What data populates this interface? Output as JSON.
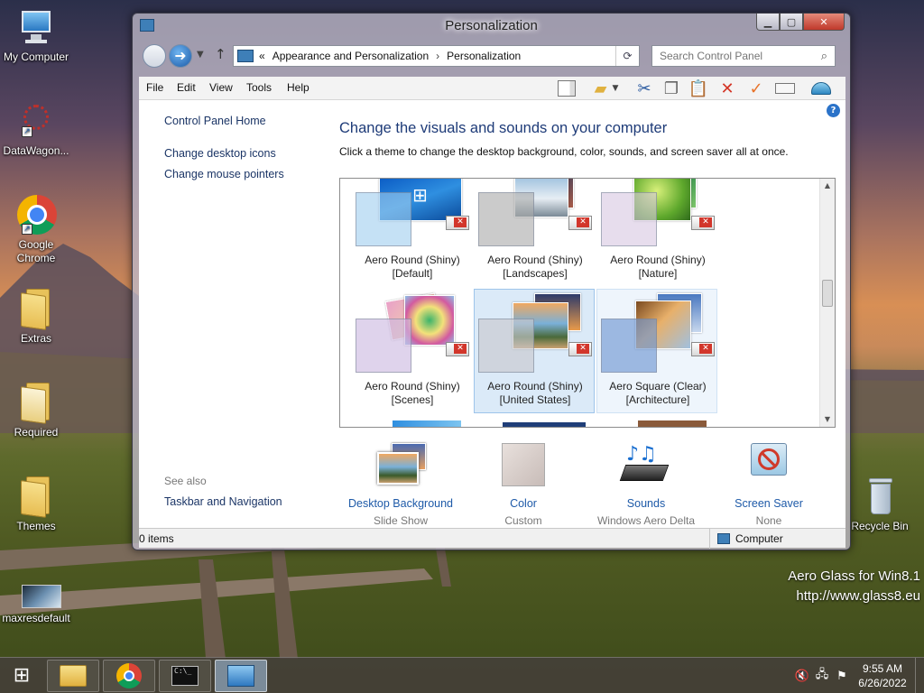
{
  "desktop": {
    "icons": [
      {
        "label": "My Computer"
      },
      {
        "label": "DataWagon..."
      },
      {
        "label": "Google Chrome"
      },
      {
        "label": "Extras"
      },
      {
        "label": "Required"
      },
      {
        "label": "Themes"
      },
      {
        "label": "maxresdefault"
      },
      {
        "label": "Recycle Bin"
      }
    ],
    "watermark": {
      "line1": "Aero Glass for Win8.1",
      "line2": "http://www.glass8.eu"
    }
  },
  "window": {
    "title": "Personalization",
    "controls": {
      "minimize": "▁",
      "maximize": "▢",
      "close": "✕"
    }
  },
  "navbar": {
    "breadcrumb_prefix": "«",
    "breadcrumb": [
      "Appearance and Personalization",
      "Personalization"
    ],
    "breadcrumb_separator": "›",
    "refresh_icon": "⟳",
    "search_placeholder": "Search Control Panel"
  },
  "menubar": {
    "items": [
      "File",
      "Edit",
      "View",
      "Tools",
      "Help"
    ],
    "toolbar_icons": [
      "layout-icon",
      "folder-options-icon",
      "cut-icon",
      "copy-icon",
      "paste-icon",
      "delete-icon",
      "check-icon",
      "properties-icon",
      "shell-icon"
    ]
  },
  "sidebar": {
    "home": "Control Panel Home",
    "links": [
      "Change desktop icons",
      "Change mouse pointers"
    ],
    "see_also_label": "See also",
    "see_also_links": [
      "Taskbar and Navigation"
    ]
  },
  "main": {
    "heading": "Change the visuals and sounds on your computer",
    "subtext": "Click a theme to change the desktop background, color, sounds, and screen saver all at once.",
    "themes": [
      {
        "name": "Aero Round (Shiny)",
        "variant": "[Default]"
      },
      {
        "name": "Aero Round (Shiny)",
        "variant": "[Landscapes]"
      },
      {
        "name": "Aero Round (Shiny)",
        "variant": "[Nature]"
      },
      {
        "name": "Aero Round (Shiny)",
        "variant": "[Scenes]"
      },
      {
        "name": "Aero Round (Shiny)",
        "variant": "[United States]"
      },
      {
        "name": "Aero Square (Clear)",
        "variant": "[Architecture]"
      }
    ],
    "selected_theme_index": 4,
    "bottom": [
      {
        "title": "Desktop Background",
        "sub": "Slide Show"
      },
      {
        "title": "Color",
        "sub": "Custom"
      },
      {
        "title": "Sounds",
        "sub": "Windows Aero Delta"
      },
      {
        "title": "Screen Saver",
        "sub": "None"
      }
    ]
  },
  "statusbar": {
    "items": "0 items",
    "location": "Computer"
  },
  "taskbar": {
    "start_icon": "windows-logo-icon",
    "apps": [
      "file-explorer-icon",
      "chrome-icon",
      "command-prompt-icon",
      "control-panel-icon"
    ],
    "tray": {
      "time": "9:55 AM",
      "date": "6/26/2022"
    }
  },
  "colors": {
    "link": "#1b3566",
    "heading": "#1e3b78",
    "selection": "#dbeaf8",
    "accent": "#2b73c9"
  }
}
